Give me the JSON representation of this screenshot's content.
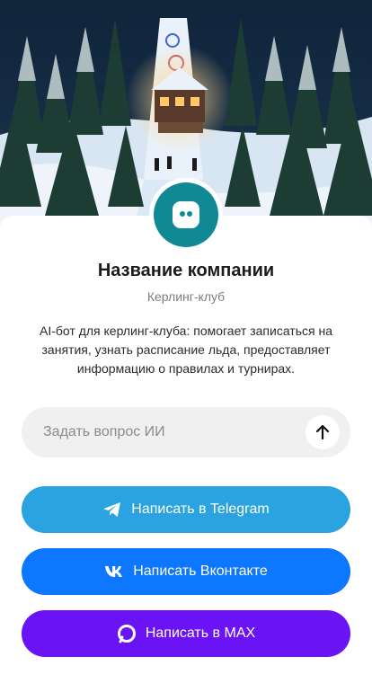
{
  "company": {
    "name": "Название компании",
    "category": "Керлинг-клуб",
    "description": "AI-бот для керлинг-клуба: помогает записаться на занятия, узнать расписание льда, предоставляет информацию о правилах и турнирах."
  },
  "ask": {
    "placeholder": "Задать вопрос ИИ",
    "send_icon": "arrow-up-icon"
  },
  "buttons": {
    "telegram": {
      "label": "Написать в Telegram",
      "icon": "telegram-icon",
      "color": "#2aa3e0"
    },
    "vk": {
      "label": "Написать Вконтакте",
      "icon": "vk-icon",
      "color": "#0d77ff"
    },
    "max": {
      "label": "Написать в MAX",
      "icon": "max-icon",
      "color": "#6a14f6"
    }
  },
  "colors": {
    "avatar": "#0f8a95"
  }
}
